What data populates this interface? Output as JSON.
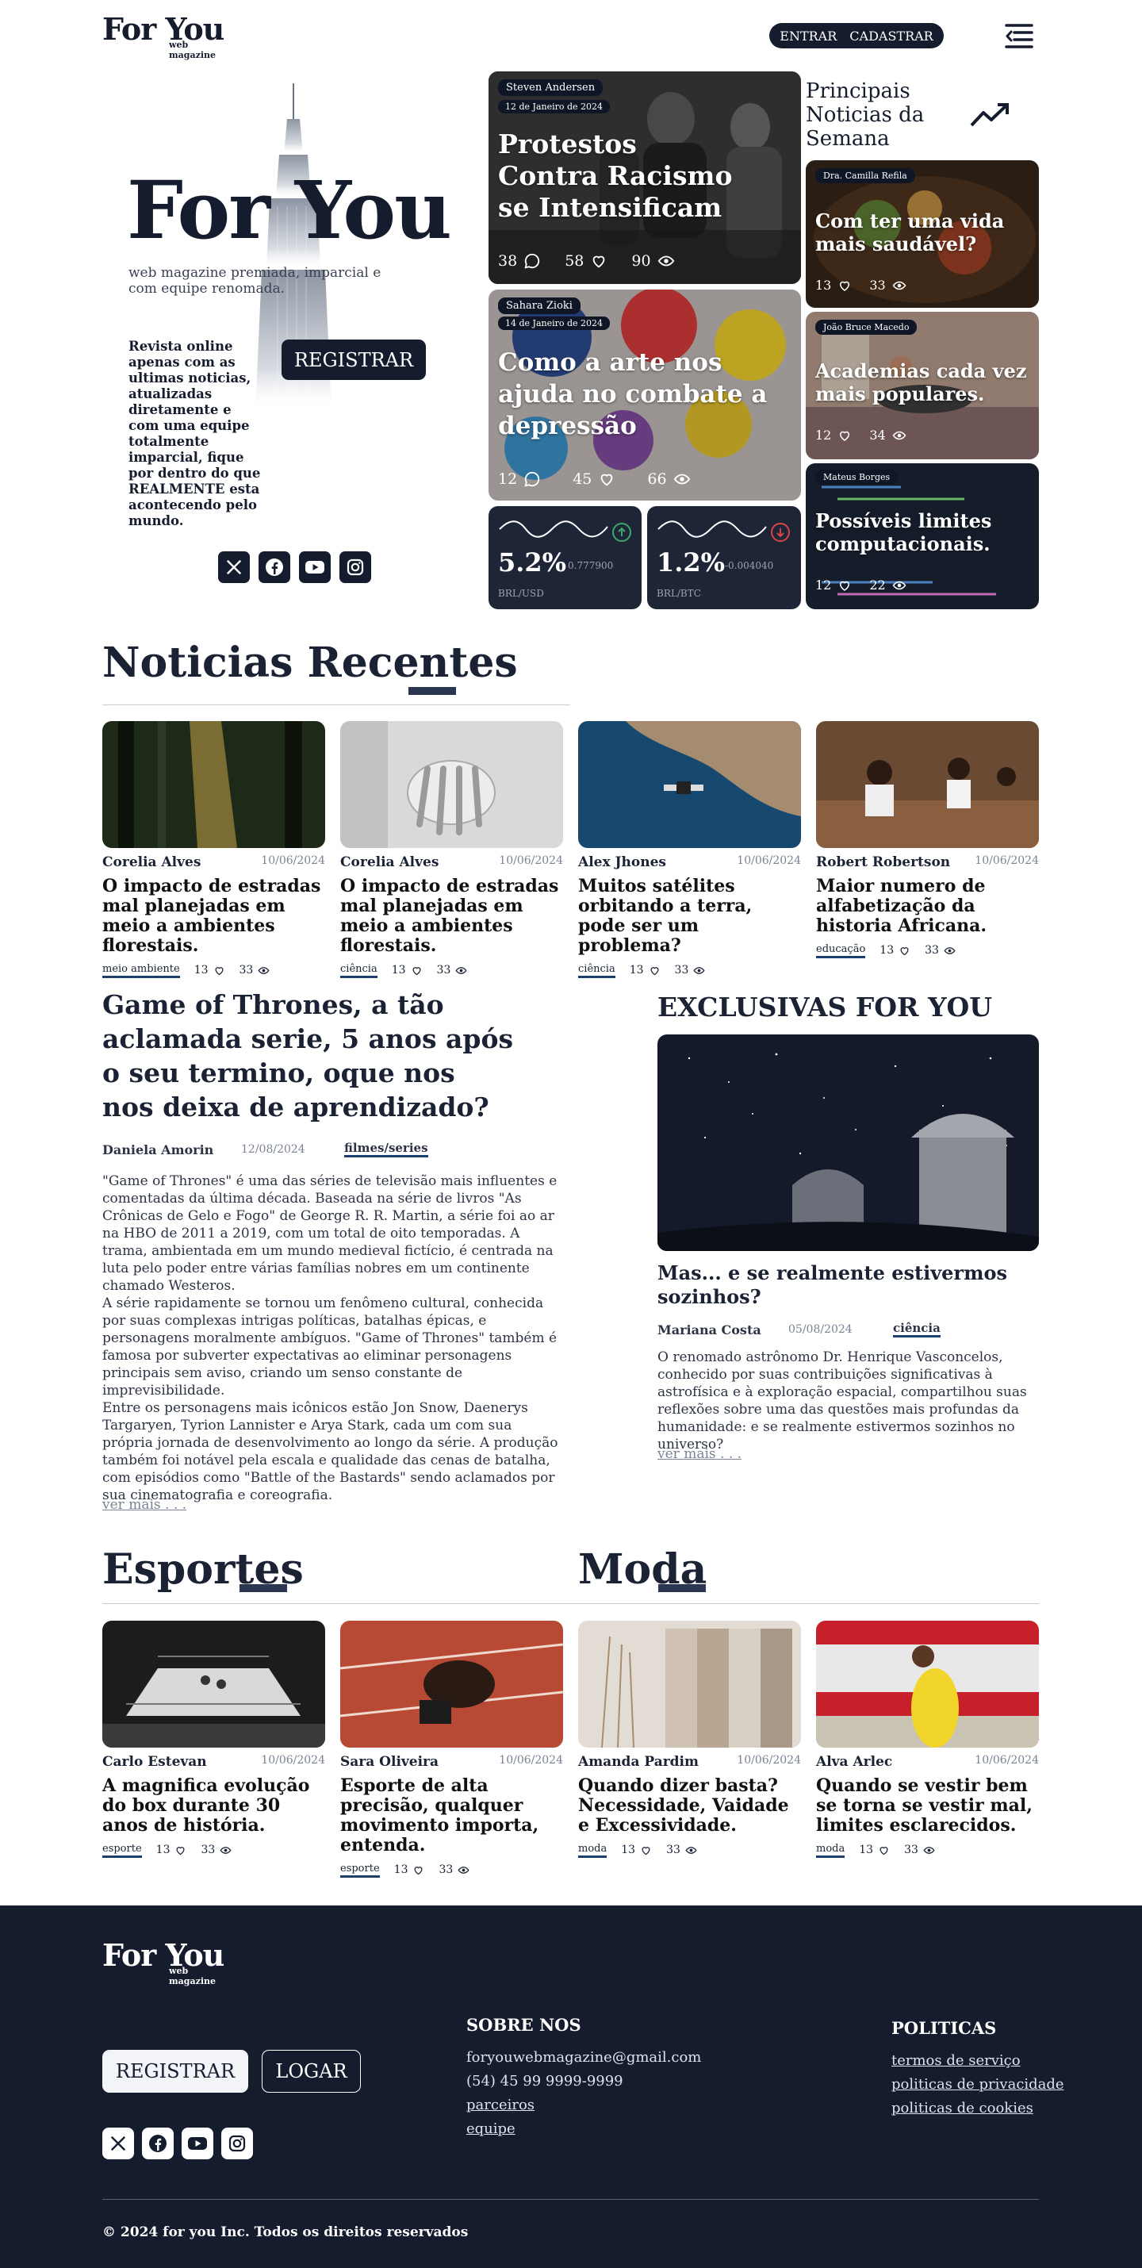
{
  "header": {
    "logo": "For You",
    "logo_sub": "web magazine",
    "login": "ENTRAR",
    "signup": "CADASTRAR"
  },
  "hero": {
    "title": "For You",
    "subtitle": "web magazine premiada, imparcial e com equipe renomada.",
    "description": "Revista online apenas com as ultimas noticias, atualizadas diretamente e com uma equipe totalmente imparcial, fique por dentro do que REALMENTE esta acontecendo pelo mundo.",
    "register": "REGISTRAR"
  },
  "featured": [
    {
      "author": "Steven Andersen",
      "date": "12 de Janeiro de 2024",
      "title": "Protestos Contra Racismo se Intensificam",
      "comments": "38",
      "likes": "58",
      "views": "90"
    },
    {
      "author": "Sahara Zioki",
      "date": "14 de Janeiro de 2024",
      "title": "Como a arte nos ajuda no combate a depressão",
      "comments": "12",
      "likes": "45",
      "views": "66"
    }
  ],
  "tickers": [
    {
      "value": "5.2%",
      "change": "0.777900",
      "pair": "BRL/USD",
      "direction": "up",
      "color": "#3fa66b"
    },
    {
      "value": "1.2%",
      "change": "-0.004040",
      "pair": "BRL/BTC",
      "direction": "down",
      "color": "#d64545"
    }
  ],
  "weekly": {
    "title": "Principais Noticias da Semana",
    "items": [
      {
        "author": "Dra. Camilla Refila",
        "title": "Com ter uma vida mais saudável?",
        "likes": "13",
        "views": "33"
      },
      {
        "author": "João Bruce Macedo",
        "title": "Academias cada vez mais populares.",
        "likes": "12",
        "views": "34"
      },
      {
        "author": "Mateus Borges",
        "title": "Possíveis limites computacionais.",
        "likes": "12",
        "views": "22"
      }
    ]
  },
  "recent": {
    "title": "Noticias Recentes",
    "items": [
      {
        "author": "Corelia Alves",
        "date": "10/06/2024",
        "title": "O impacto de estradas mal planejadas em meio a ambientes florestais.",
        "category": "meio ambiente",
        "likes": "13",
        "views": "33"
      },
      {
        "author": "Corelia Alves",
        "date": "10/06/2024",
        "title": "O impacto de estradas mal planejadas em meio a ambientes florestais.",
        "category": "ciência",
        "likes": "13",
        "views": "33"
      },
      {
        "author": "Alex Jhones",
        "date": "10/06/2024",
        "title": "Muitos satélites orbitando a terra, pode ser um problema?",
        "category": "ciência",
        "likes": "13",
        "views": "33"
      },
      {
        "author": "Robert Robertson",
        "date": "10/06/2024",
        "title": "Maior numero de alfabetização da historia Africana.",
        "category": "educação",
        "likes": "13",
        "views": "33"
      }
    ]
  },
  "feature_article": {
    "title": "Game of Thrones, a tão aclamada serie, 5 anos após o seu termino, oque nos nos deixa de  aprendizado?",
    "author": "Daniela Amorin",
    "date": "12/08/2024",
    "category": "filmes/series",
    "p1": "\"Game of Thrones\" é uma das séries de televisão mais influentes e comentadas da última década. Baseada na série de livros \"As Crônicas de Gelo e Fogo\" de George R. R. Martin, a série foi ao ar na HBO de 2011 a 2019, com um total de oito temporadas. A trama, ambientada em um mundo medieval fictício, é centrada na luta pelo poder entre várias famílias nobres em um continente chamado Westeros.",
    "p2": "A série rapidamente se tornou um fenômeno cultural, conhecida por suas complexas intrigas políticas, batalhas épicas, e personagens moralmente ambíguos. \"Game of Thrones\" também é famosa por subverter expectativas ao eliminar personagens principais sem aviso, criando um senso constante de imprevisibilidade.",
    "p3": "Entre os personagens mais icônicos estão Jon Snow, Daenerys Targaryen, Tyrion Lannister e Arya Stark, cada um com sua própria jornada de desenvolvimento ao longo da série. A produção também foi notável pela escala e qualidade das cenas de batalha, com episódios como \"Battle of the Bastards\" sendo aclamados por sua cinematografia e coreografia.",
    "more": "ver mais . . ."
  },
  "exclusive": {
    "heading": "EXCLUSIVAS FOR YOU",
    "title": "Mas... e se realmente estivermos sozinhos?",
    "author": "Mariana Costa",
    "date": "05/08/2024",
    "category": "ciência",
    "text": "O renomado astrônomo Dr. Henrique Vasconcelos, conhecido por suas contribuições significativas à astrofísica e à exploração espacial, compartilhou suas reflexões sobre uma das questões mais profundas da humanidade: e se realmente estivermos sozinhos no universo?",
    "more": "ver mais . . ."
  },
  "sports": {
    "title": "Esportes"
  },
  "fashion": {
    "title": "Moda"
  },
  "sections": [
    {
      "author": "Carlo Estevan",
      "date": "10/06/2024",
      "title": "A magnifica evolução do box durante 30 anos de história.",
      "category": "esporte",
      "likes": "13",
      "views": "33"
    },
    {
      "author": "Sara Oliveira",
      "date": "10/06/2024",
      "title": "Esporte de alta precisão, qualquer movimento importa, entenda.",
      "category": "esporte",
      "likes": "13",
      "views": "33"
    },
    {
      "author": "Amanda Pardim",
      "date": "10/06/2024",
      "title": "Quando dizer basta? Necessidade, Vaidade e Excessividade.",
      "category": "moda",
      "likes": "13",
      "views": "33"
    },
    {
      "author": "Alva Arlec",
      "date": "10/06/2024",
      "title": "Quando se vestir bem se torna se vestir mal, limites esclarecidos.",
      "category": "moda",
      "likes": "13",
      "views": "33"
    }
  ],
  "footer": {
    "logo": "For You",
    "logo_sub": "web magazine",
    "register": "REGISTRAR",
    "login": "LOGAR",
    "about_title": "SOBRE NOS",
    "email": "foryouwebmagazine@gmail.com",
    "phone": "(54) 45  99 9999-9999",
    "partners": "parceiros",
    "team": "equipe",
    "policies_title": "POLITICAS",
    "terms": "termos de serviço",
    "privacy": "politicas de privacidade",
    "cookies": "politicas de cookies",
    "copyright": "© 2024 for you Inc. Todos os direitos reservados"
  },
  "icons": [
    "x-icon",
    "facebook-icon",
    "youtube-icon",
    "instagram-icon",
    "menu-icon",
    "trending-icon",
    "comment-icon",
    "heart-icon",
    "eye-icon"
  ]
}
